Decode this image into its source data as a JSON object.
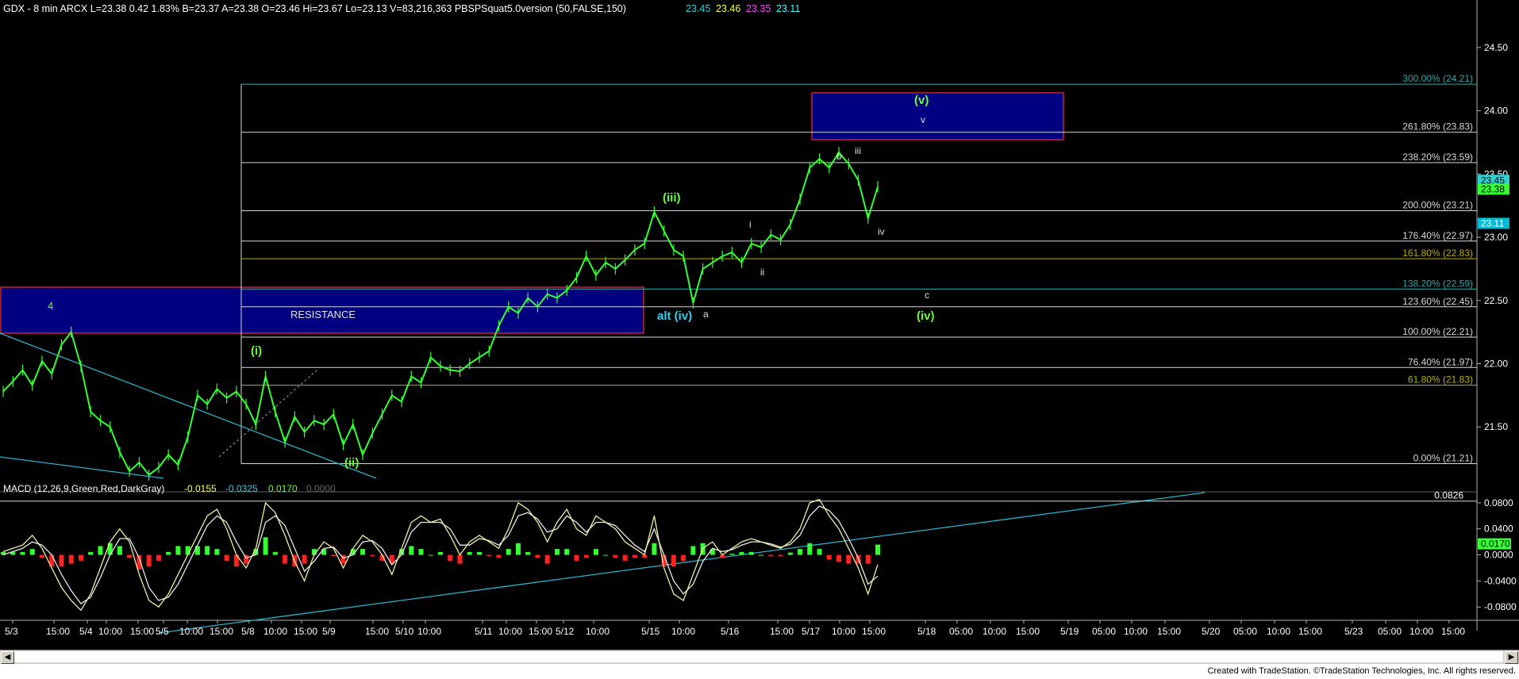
{
  "header": {
    "title": "GDX - 8 min  ARCX  L=23.38  0.42  1.83% B=23.37  A=23.38  O=23.46  Hi=23.67  Lo=23.13  V=83,216,363  PBSPSquat5.0version (50,FALSE,150)",
    "extra_values": [
      "23.45",
      "23.46",
      "23.35",
      "23.11"
    ]
  },
  "colors": {
    "background": "#000000",
    "price": "#33ff33",
    "box_fill": "#000080",
    "box_border": "#cc2222",
    "fib_white": "#d8d8d8",
    "fib_olive": "#b8b000",
    "fib_teal": "#2fa8a8",
    "trendline": "#2ab0c8",
    "macd_line": "#f0f0a0",
    "signal_line": "#e8e8e8",
    "hist_pos": "#33ff33",
    "hist_neg": "#ff2020",
    "wave_green": "#66ff33",
    "wave_white": "#e0e0e0",
    "axis_text": "#ffffff"
  },
  "chart_data": [
    {
      "type": "line",
      "panel": "price",
      "title": "GDX - 8 min ARCX",
      "ylim": [
        21.05,
        24.75
      ],
      "y_ticks": [
        "24.50",
        "24.00",
        "23.50",
        "23.00",
        "22.50",
        "22.00",
        "21.50"
      ],
      "last_price_labels": [
        "23.45",
        "23.38",
        "23.11"
      ],
      "x_axis": [
        "5/3",
        "15:00",
        "5/4",
        "10:00",
        "15:00",
        "5/5",
        "10:00",
        "15:00",
        "5/8",
        "10:00",
        "15:00",
        "5/9",
        "15:00",
        "5/10",
        "10:00",
        "5/11",
        "10:00",
        "15:00",
        "5/12",
        "10:00",
        "5/15",
        "10:00",
        "5/16",
        "15:00",
        "5/17",
        "10:00",
        "15:00",
        "5/18",
        "05:00",
        "10:00",
        "15:00",
        "5/19",
        "05:00",
        "10:00",
        "15:00",
        "5/20",
        "05:00",
        "10:00",
        "15:00",
        "5/23",
        "05:00",
        "10:00",
        "15:00"
      ],
      "series": [
        {
          "values": [
            21.78,
            21.86,
            21.95,
            21.83,
            22.02,
            21.92,
            22.15,
            22.25,
            21.98,
            21.62,
            21.55,
            21.5,
            21.3,
            21.15,
            21.22,
            21.12,
            21.18,
            21.28,
            21.2,
            21.42,
            21.75,
            21.68,
            21.8,
            21.73,
            21.78,
            21.68,
            21.52,
            21.9,
            21.62,
            21.38,
            21.58,
            21.46,
            21.55,
            21.52,
            21.6,
            21.36,
            21.52,
            21.28,
            21.45,
            21.6,
            21.75,
            21.7,
            21.9,
            21.85,
            22.05,
            21.98,
            21.95,
            21.94,
            22.0,
            22.05,
            22.1,
            22.3,
            22.45,
            22.4,
            22.52,
            22.45,
            22.55,
            22.52,
            22.58,
            22.68,
            22.85,
            22.7,
            22.8,
            22.75,
            22.82,
            22.9,
            22.95,
            23.2,
            23.05,
            22.9,
            22.85,
            22.48,
            22.75,
            22.8,
            22.85,
            22.88,
            22.8,
            22.95,
            22.92,
            23.02,
            22.98,
            23.1,
            23.3,
            23.55,
            23.62,
            23.55,
            23.67,
            23.58,
            23.45,
            23.15,
            23.4
          ],
          "note": "Price trace approximating bars from 5/3 to 5/17"
        }
      ],
      "fib_levels": [
        {
          "label": "300.00% (24.21)",
          "value": 24.21,
          "color": "teal"
        },
        {
          "label": "261.80% (23.83)",
          "value": 23.83,
          "color": "white"
        },
        {
          "label": "238.20% (23.59)",
          "value": 23.59,
          "color": "white"
        },
        {
          "label": "200.00% (23.21)",
          "value": 23.21,
          "color": "white"
        },
        {
          "label": "176.40% (22.97)",
          "value": 22.97,
          "color": "white"
        },
        {
          "label": "161.80% (22.83)",
          "value": 22.83,
          "color": "olive"
        },
        {
          "label": "138.20% (22.59)",
          "value": 22.59,
          "color": "teal"
        },
        {
          "label": "123.60% (22.45)",
          "value": 22.45,
          "color": "white"
        },
        {
          "label": "100.00% (22.21)",
          "value": 22.21,
          "color": "white"
        },
        {
          "label": "76.40% (21.97)",
          "value": 21.97,
          "color": "white"
        },
        {
          "label": "61.80% (21.83)",
          "value": 21.83,
          "color": "olive"
        },
        {
          "label": "0.00% (21.21)",
          "value": 21.21,
          "color": "white"
        }
      ],
      "annotations": {
        "resistance_label": "RESISTANCE",
        "green_waves": [
          "4",
          "(i)",
          "(ii)",
          "(iii)",
          "(iv)",
          "(v)"
        ],
        "alt_label": "alt (iv)",
        "white_waves": [
          "a",
          "b",
          "c",
          "i",
          "ii",
          "iii",
          "iv",
          "v"
        ]
      },
      "grid": false
    },
    {
      "type": "line",
      "panel": "macd",
      "title": "MACD (12,26,9,Green,Red,DarkGray)",
      "header_values": [
        "-0.0155",
        "-0.0325",
        "0.0170",
        "0.0000"
      ],
      "ylim": [
        -0.098,
        0.092
      ],
      "y_ticks": [
        "0.0800",
        "0.0400",
        "0.0000",
        "-0.0400",
        "-0.0800"
      ],
      "reference_level": {
        "label": "0.0826",
        "value": 0.0826
      },
      "last_value_label": "0.0170",
      "series": [
        {
          "name": "MACD",
          "values": [
            0.005,
            0.01,
            0.015,
            0.03,
            0.01,
            -0.02,
            -0.05,
            -0.07,
            -0.085,
            -0.06,
            -0.02,
            0.02,
            0.04,
            0.02,
            -0.03,
            -0.07,
            -0.08,
            -0.06,
            -0.03,
            0.0,
            0.03,
            0.06,
            0.07,
            0.04,
            0.0,
            -0.02,
            0.01,
            0.08,
            0.065,
            0.03,
            -0.01,
            -0.04,
            0.0,
            0.02,
            0.01,
            -0.02,
            0.01,
            0.03,
            0.02,
            0.0,
            -0.03,
            0.01,
            0.05,
            0.06,
            0.05,
            0.055,
            0.03,
            0.0,
            0.02,
            0.03,
            0.02,
            0.01,
            0.04,
            0.08,
            0.07,
            0.05,
            0.02,
            0.05,
            0.07,
            0.04,
            0.03,
            0.06,
            0.05,
            0.04,
            0.02,
            0.01,
            0.0,
            0.06,
            -0.02,
            -0.06,
            -0.07,
            -0.03,
            0.01,
            0.02,
            0.0,
            0.01,
            0.02,
            0.025,
            0.02,
            0.015,
            0.01,
            0.02,
            0.04,
            0.08,
            0.085,
            0.06,
            0.04,
            0.01,
            -0.02,
            -0.06,
            -0.015
          ]
        },
        {
          "name": "Signal",
          "values": [
            0.0,
            0.005,
            0.01,
            0.02,
            0.015,
            0.0,
            -0.03,
            -0.055,
            -0.075,
            -0.065,
            -0.035,
            0.0,
            0.025,
            0.025,
            -0.005,
            -0.05,
            -0.07,
            -0.065,
            -0.045,
            -0.015,
            0.015,
            0.045,
            0.06,
            0.05,
            0.02,
            -0.005,
            0.0,
            0.05,
            0.06,
            0.045,
            0.01,
            -0.025,
            -0.01,
            0.01,
            0.012,
            -0.005,
            0.0,
            0.02,
            0.022,
            0.01,
            -0.015,
            0.0,
            0.035,
            0.05,
            0.05,
            0.05,
            0.04,
            0.015,
            0.015,
            0.025,
            0.022,
            0.015,
            0.03,
            0.06,
            0.065,
            0.055,
            0.035,
            0.04,
            0.06,
            0.05,
            0.035,
            0.05,
            0.05,
            0.045,
            0.03,
            0.015,
            0.005,
            0.04,
            0.0,
            -0.04,
            -0.06,
            -0.045,
            -0.01,
            0.01,
            0.005,
            0.008,
            0.015,
            0.02,
            0.02,
            0.017,
            0.012,
            0.016,
            0.03,
            0.06,
            0.075,
            0.068,
            0.052,
            0.025,
            -0.005,
            -0.045,
            -0.0325
          ]
        }
      ],
      "grid": false
    }
  ],
  "footer": {
    "credit": "Created with TradeStation. ©TradeStation Technologies, Inc. All rights reserved."
  },
  "scrollbar": {
    "left_arrow": "◀",
    "right_arrow": "▶"
  }
}
